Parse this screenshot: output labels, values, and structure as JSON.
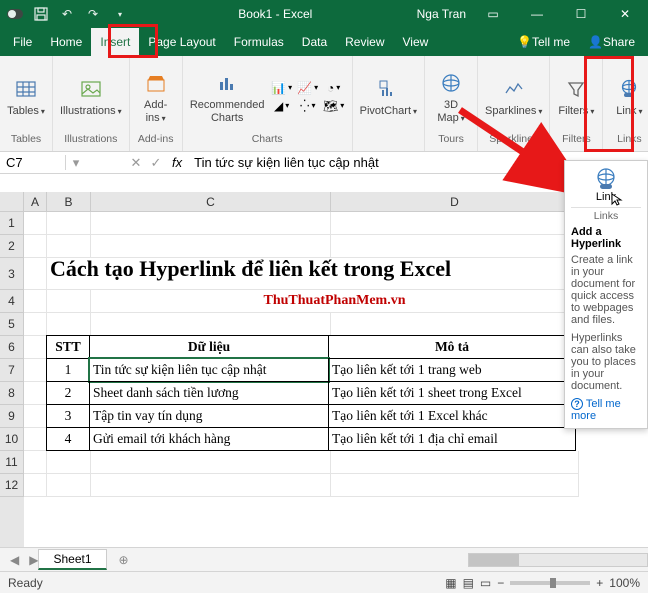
{
  "title": {
    "book": "Book1",
    "app": "Excel",
    "user": "Nga Tran"
  },
  "qat": {
    "autosave": "AutoSave"
  },
  "menus": [
    "File",
    "Home",
    "Insert",
    "Page Layout",
    "Formulas",
    "Data",
    "Review",
    "View",
    "Tell me",
    "Share"
  ],
  "ribbon": {
    "groups": [
      {
        "label": "Tables",
        "items": [
          {
            "label": "Tables",
            "icon": "table-icon"
          }
        ]
      },
      {
        "label": "Illustrations",
        "items": [
          {
            "label": "Illustrations",
            "icon": "picture-icon"
          }
        ]
      },
      {
        "label": "Add-ins",
        "items": [
          {
            "label": "Add-ins",
            "icon": "store-icon"
          }
        ]
      },
      {
        "label": "Charts",
        "items": [
          {
            "label": "Recommended Charts",
            "icon": "rec-chart-icon"
          }
        ],
        "minis": [
          "bar",
          "line",
          "pie",
          "area",
          "scatter",
          "map"
        ]
      },
      {
        "label": "",
        "items": [
          {
            "label": "PivotChart",
            "icon": "pivot-icon"
          }
        ]
      },
      {
        "label": "Tours",
        "items": [
          {
            "label": "3D Map",
            "icon": "globe-icon"
          }
        ]
      },
      {
        "label": "Sparklines",
        "items": [
          {
            "label": "Sparklines",
            "icon": "spark-icon"
          }
        ]
      },
      {
        "label": "Filters",
        "items": [
          {
            "label": "Filters",
            "icon": "filter-icon"
          }
        ]
      },
      {
        "label": "Links",
        "items": [
          {
            "label": "Link",
            "icon": "link-icon"
          }
        ]
      }
    ]
  },
  "namebox": "C7",
  "formula": "Tin tức sự kiện liên tục cập nhật",
  "bigtitle": "Cách tạo Hyperlink để liên kết trong Excel",
  "subtitle": "ThuThuatPhanMem.vn",
  "table": {
    "headers": [
      "STT",
      "Dữ liệu",
      "Mô tả"
    ],
    "rows": [
      {
        "stt": "1",
        "du": "Tin tức sự kiện liên tục cập nhật",
        "mo": "Tạo liên kết tới 1 trang web"
      },
      {
        "stt": "2",
        "du": "Sheet danh sách tiền lương",
        "mo": "Tạo liên kết tới 1 sheet trong Excel"
      },
      {
        "stt": "3",
        "du": "Tập tin vay tín dụng",
        "mo": "Tạo liên kết tới 1 Excel khác"
      },
      {
        "stt": "4",
        "du": "Gửi email tới khách hàng",
        "mo": "Tạo liên kết tới 1 địa chỉ email"
      }
    ]
  },
  "sheet": "Sheet1",
  "status": "Ready",
  "zoom": "100%",
  "tooltip": {
    "link_label": "Link",
    "links_label": "Links",
    "title": "Add a Hyperlink",
    "desc1": "Create a link in your document for quick access to webpages and files.",
    "desc2": "Hyperlinks can also take you to places in your document.",
    "tell": "Tell me more"
  }
}
